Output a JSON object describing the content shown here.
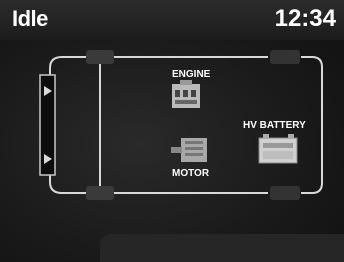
{
  "status": {
    "mode": "Idle",
    "time": "12:34"
  },
  "diagram": {
    "engine_label": "ENGINE",
    "motor_label": "MOTOR",
    "battery_label": "HV BATTERY"
  },
  "colors": {
    "frame_line": "#d8d8d8",
    "tire": "#3a3a3a",
    "text": "#ffffff"
  }
}
